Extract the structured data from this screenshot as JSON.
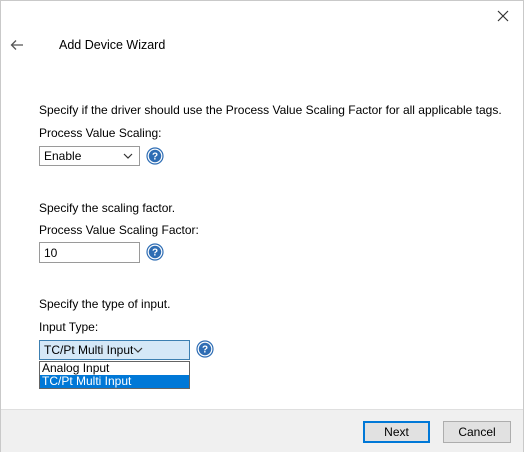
{
  "window": {
    "title": "Add Device Wizard"
  },
  "scaling_section": {
    "description": "Specify if the driver should use the Process Value Scaling Factor for all applicable tags.",
    "field_label": "Process Value Scaling:",
    "selected_value": "Enable"
  },
  "factor_section": {
    "description": "Specify the scaling factor.",
    "field_label": "Process Value Scaling Factor:",
    "value": "10"
  },
  "input_section": {
    "description": "Specify the type of input.",
    "field_label": "Input Type:",
    "selected_value": "TC/Pt Multi Input",
    "options": [
      "Analog Input",
      "TC/Pt Multi Input"
    ]
  },
  "footer": {
    "next_label": "Next",
    "cancel_label": "Cancel"
  },
  "colors": {
    "accent": "#0078d7",
    "help_icon": "#2e6db4",
    "footer_bg": "#f0f0f0"
  },
  "icons": [
    "close-icon",
    "back-arrow-icon",
    "help-icon",
    "chevron-down-icon"
  ]
}
